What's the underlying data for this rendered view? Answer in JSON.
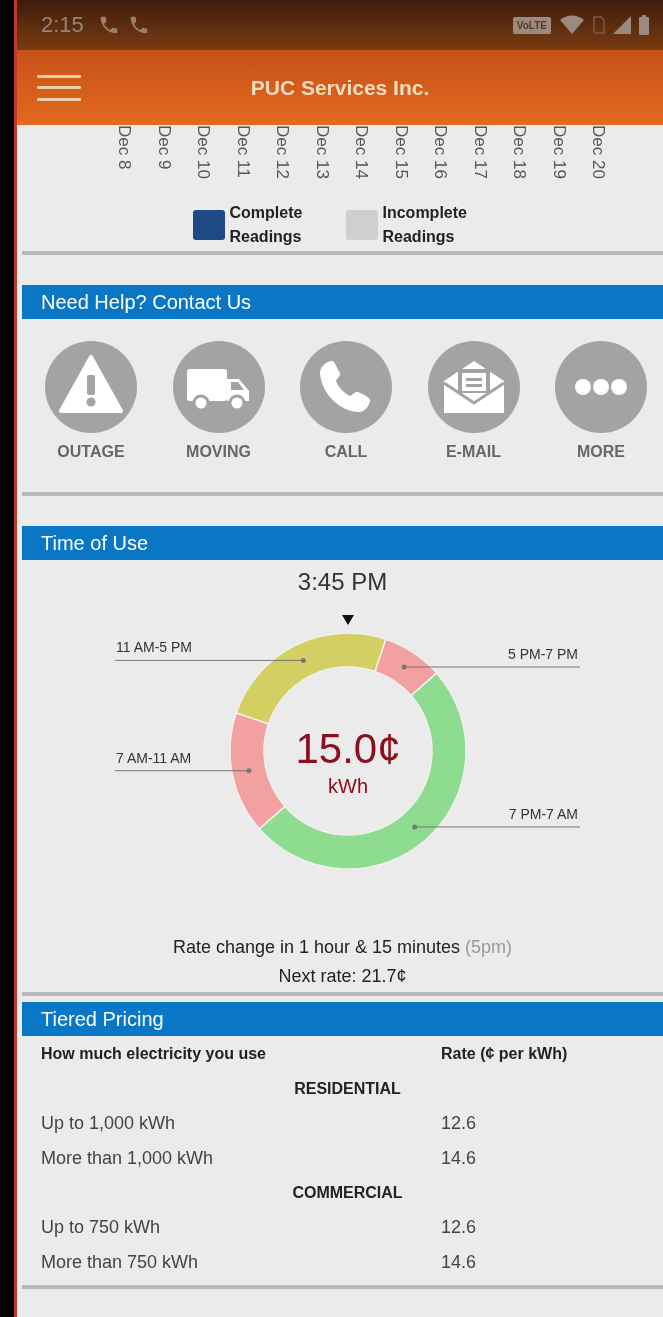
{
  "status_bar": {
    "time": "2:15",
    "network": "VoLTE"
  },
  "app_bar": {
    "title": "PUC Services Inc."
  },
  "readings_chart": {
    "dates": [
      "Dec 8",
      "Dec 9",
      "Dec 10",
      "Dec 11",
      "Dec 12",
      "Dec 13",
      "Dec 14",
      "Dec 15",
      "Dec 16",
      "Dec 17",
      "Dec 18",
      "Dec 19",
      "Dec 20"
    ],
    "legend": [
      {
        "label": "Complete Readings",
        "color": "#1f4a85"
      },
      {
        "label": "Incomplete Readings",
        "color": "#cfcfcf"
      }
    ]
  },
  "contact": {
    "title": "Need Help? Contact Us",
    "actions": [
      {
        "label": "OUTAGE",
        "kind": "warning"
      },
      {
        "label": "MOVING",
        "kind": "truck"
      },
      {
        "label": "CALL",
        "kind": "phone"
      },
      {
        "label": "E-MAIL",
        "kind": "mail"
      },
      {
        "label": "MORE",
        "kind": "more"
      }
    ]
  },
  "time_of_use": {
    "title": "Time of Use",
    "current_time": "3:45 PM",
    "rate": "15.0¢",
    "unit": "kWh",
    "chart_data": {
      "type": "donut",
      "categories": [
        "11 AM-5 PM",
        "5 PM-7 PM",
        "7 PM-7 AM",
        "7 AM-11 AM"
      ],
      "values": [
        25,
        8.33,
        50,
        16.67
      ],
      "colors": [
        "#d4cf63",
        "#f2a0a0",
        "#8ddc8f",
        "#f2a0a0"
      ]
    },
    "rate_change": {
      "text": "Rate change in 1 hour & 15 minutes",
      "note": "(5pm)"
    },
    "next_rate": "Next rate: 21.7¢"
  },
  "tiered_pricing": {
    "title": "Tiered Pricing",
    "columns": [
      "How much electricity you use",
      "Rate (¢ per kWh)"
    ],
    "groups": [
      {
        "name": "RESIDENTIAL",
        "rows": [
          {
            "usage": "Up to 1,000 kWh",
            "rate": "12.6"
          },
          {
            "usage": "More than 1,000 kWh",
            "rate": "14.6"
          }
        ]
      },
      {
        "name": "COMMERCIAL",
        "rows": [
          {
            "usage": "Up to 750 kWh",
            "rate": "12.6"
          },
          {
            "usage": "More than 750 kWh",
            "rate": "14.6"
          }
        ]
      }
    ]
  }
}
